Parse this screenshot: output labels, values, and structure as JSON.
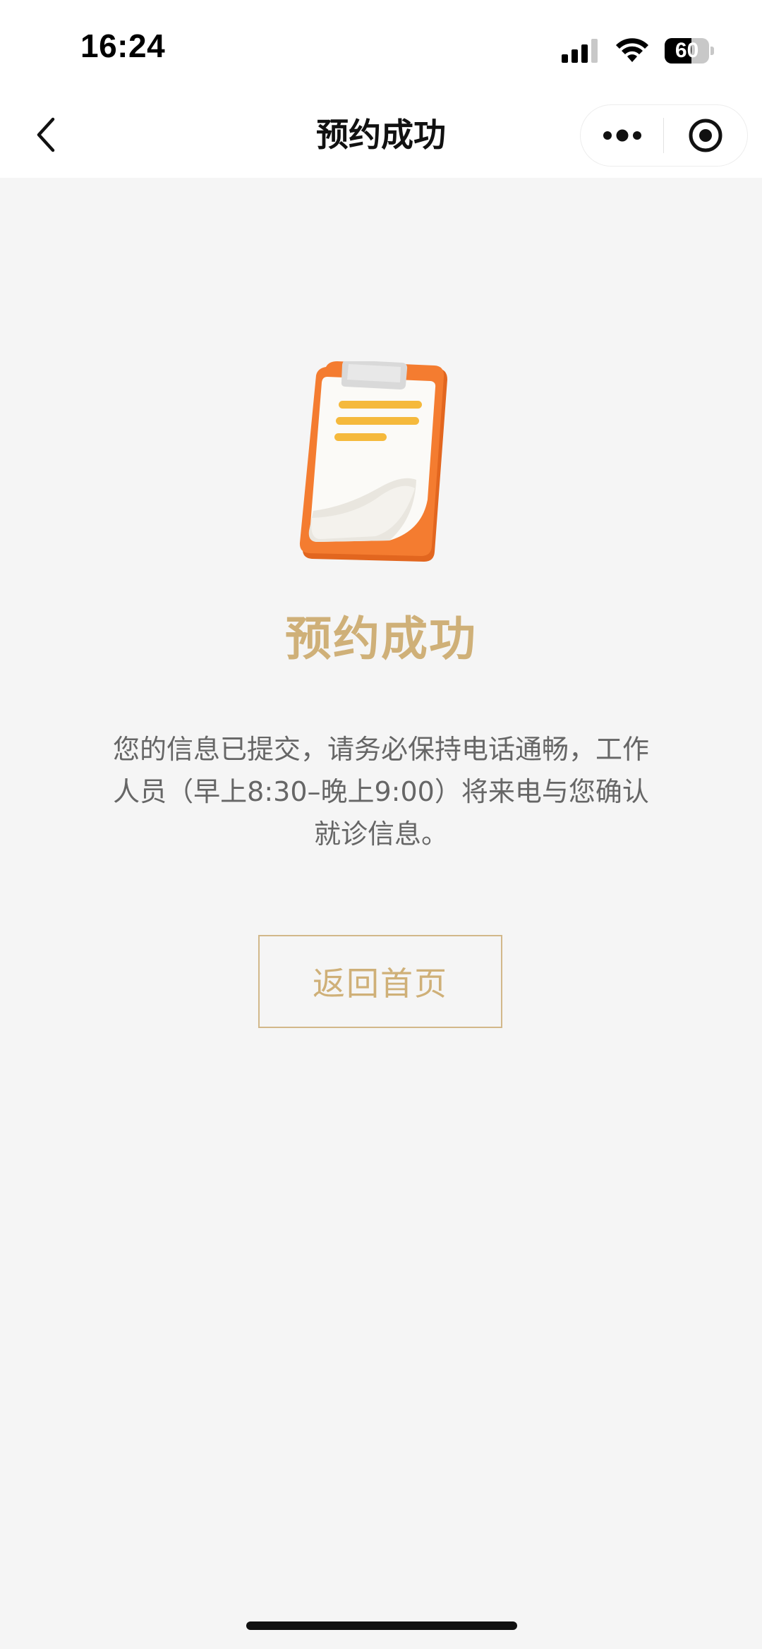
{
  "status_bar": {
    "time": "16:24",
    "battery_level": "60",
    "battery_fraction": 0.6,
    "icons": [
      "signal-icon",
      "wifi-icon",
      "battery-icon"
    ]
  },
  "nav_bar": {
    "title": "预约成功",
    "icons": [
      "back-chevron-icon",
      "more-dots-icon",
      "close-target-icon"
    ]
  },
  "result": {
    "icon": "clipboard-icon",
    "title": "预约成功",
    "description": "您的信息已提交，请务必保持电话通畅，工作人员（早上8:30–晚上9:00）将来电与您确认就诊信息。",
    "button_label": "返回首页"
  },
  "colors": {
    "accent_gold": "#cfb078",
    "button_border": "#d2b88a",
    "background": "#f5f5f5",
    "clipboard_orange": "#f07a2e",
    "paper_lines": "#f5b93c"
  }
}
